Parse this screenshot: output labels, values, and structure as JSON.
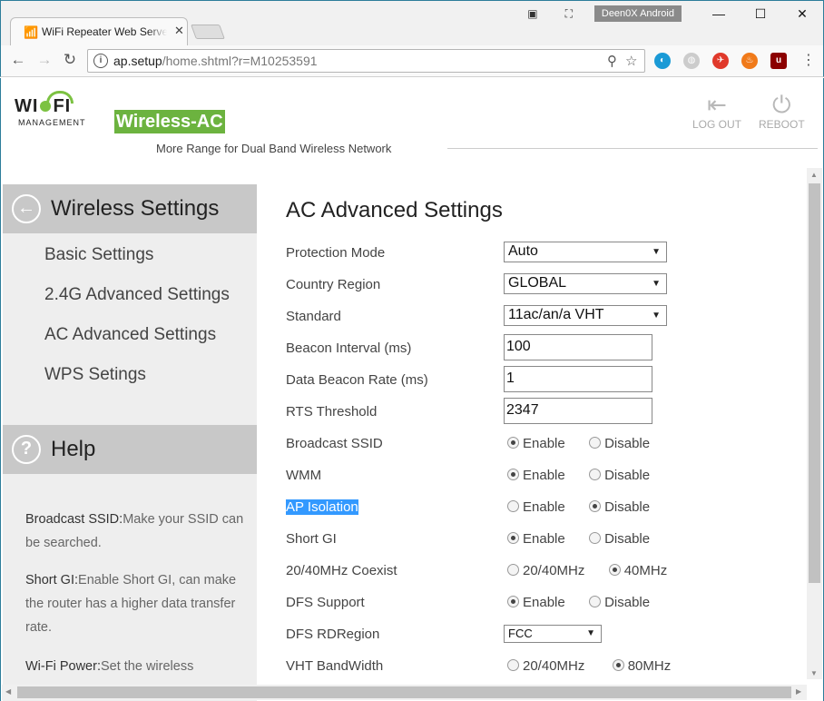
{
  "browser": {
    "tab_title": "WiFi Repeater Web Server",
    "tab_close": "✕",
    "profile_name": "Deen0X Android",
    "url_domain": "ap.setup",
    "url_path": "/home.shtml?r=M10253591",
    "win_minimize": "—",
    "win_maximize": "☐",
    "win_close": "✕"
  },
  "header": {
    "logo_left": "WI",
    "logo_right": "FI",
    "logo_sub": "MANAGEMENT",
    "badge": "Wireless-AC",
    "tagline": "More Range for Dual Band Wireless Network",
    "logout_label": "LOG OUT",
    "reboot_label": "REBOOT"
  },
  "sidebar": {
    "section_title": "Wireless Settings",
    "items": [
      {
        "label": "Basic Settings"
      },
      {
        "label": "2.4G Advanced Settings"
      },
      {
        "label": "AC Advanced Settings"
      },
      {
        "label": "WPS Setings"
      }
    ],
    "help_title": "Help",
    "help": [
      {
        "term": "Broadcast SSID:",
        "desc": "Make your SSID can be searched."
      },
      {
        "term": "Short GI:",
        "desc": "Enable Short GI, can make the router has a higher data transfer rate."
      },
      {
        "term": "Wi-Fi Power:",
        "desc": "Set the wireless"
      }
    ]
  },
  "main": {
    "title": "AC Advanced Settings",
    "protection_mode": {
      "label": "Protection Mode",
      "value": "Auto"
    },
    "country_region": {
      "label": "Country Region",
      "value": "GLOBAL"
    },
    "standard": {
      "label": "Standard",
      "value": "11ac/an/a VHT"
    },
    "beacon_interval": {
      "label": "Beacon Interval (ms)",
      "value": "100"
    },
    "data_beacon_rate": {
      "label": "Data Beacon Rate (ms)",
      "value": "1"
    },
    "rts_threshold": {
      "label": "RTS Threshold",
      "value": "2347"
    },
    "broadcast_ssid": {
      "label": "Broadcast SSID",
      "opt1": "Enable",
      "opt2": "Disable",
      "selected": "Enable"
    },
    "wmm": {
      "label": "WMM",
      "opt1": "Enable",
      "opt2": "Disable",
      "selected": "Enable"
    },
    "ap_isolation": {
      "label": "AP Isolation",
      "opt1": "Enable",
      "opt2": "Disable",
      "selected": "Disable"
    },
    "short_gi": {
      "label": "Short GI",
      "opt1": "Enable",
      "opt2": "Disable",
      "selected": "Enable"
    },
    "coexist": {
      "label": "20/40MHz Coexist",
      "opt1": "20/40MHz",
      "opt2": "40MHz",
      "selected": "40MHz"
    },
    "dfs_support": {
      "label": "DFS Support",
      "opt1": "Enable",
      "opt2": "Disable",
      "selected": "Enable"
    },
    "dfs_rdregion": {
      "label": "DFS RDRegion",
      "value": "FCC"
    },
    "vht_bandwidth": {
      "label": "VHT BandWidth",
      "opt1": "20/40MHz",
      "opt2": "80MHz",
      "selected": "80MHz"
    }
  }
}
